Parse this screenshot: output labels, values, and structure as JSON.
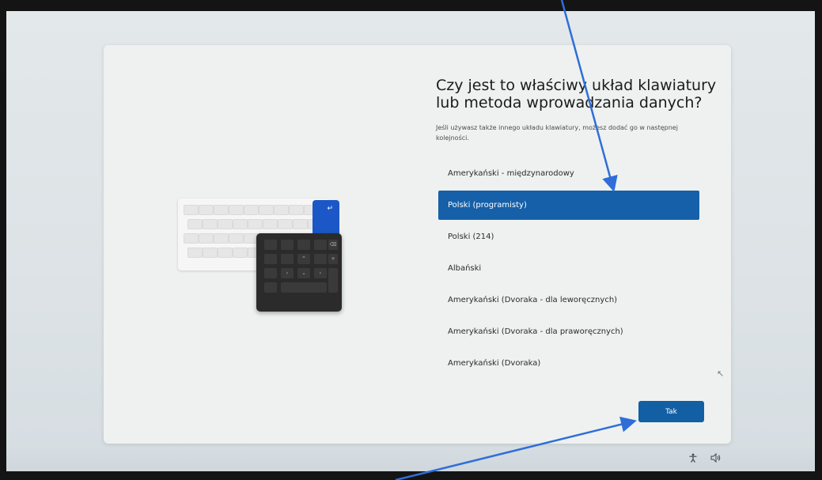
{
  "setup": {
    "title": "Czy jest to właściwy układ klawiatury lub metoda wprowadzania danych?",
    "description": "Jeśli używasz także innego układu klawiatury, możesz dodać go w następnej kolejności.",
    "layouts": [
      {
        "label": "Amerykański - międzynarodowy",
        "selected": false
      },
      {
        "label": "Polski (programisty)",
        "selected": true
      },
      {
        "label": "Polski (214)",
        "selected": false
      },
      {
        "label": "Albański",
        "selected": false
      },
      {
        "label": "Amerykański (Dvoraka - dla leworęcznych)",
        "selected": false
      },
      {
        "label": "Amerykański (Dvoraka - dla praworęcznych)",
        "selected": false
      },
      {
        "label": "Amerykański (Dvoraka)",
        "selected": false
      }
    ],
    "confirm_label": "Tak"
  },
  "numpad": {
    "backspace_glyph": "⌫",
    "plus_glyph": "+",
    "up_glyph": "^",
    "left_glyph": "‹",
    "down_glyph": "⌄",
    "right_glyph": "›",
    "enter_glyph": "↵"
  },
  "tray": {
    "accessibility_icon": "accessibility-icon",
    "volume_icon": "volume-icon"
  },
  "colors": {
    "accent": "#1560a8",
    "annotation_arrow": "#2f6ed8",
    "numpad": "#2b2b2b"
  }
}
